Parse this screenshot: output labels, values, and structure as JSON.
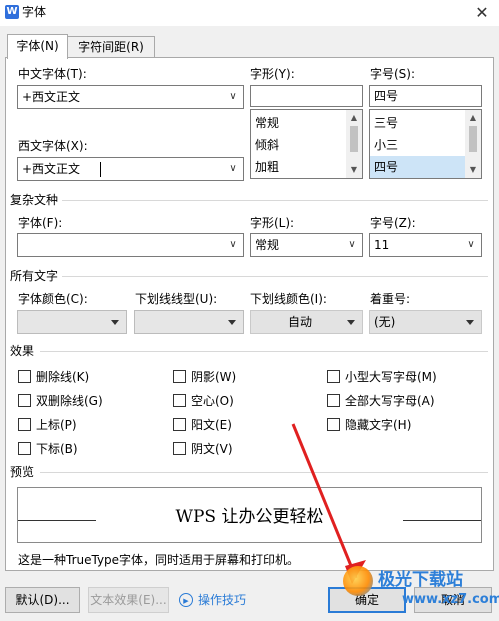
{
  "window": {
    "title": "字体",
    "app_icon_glyph": "W",
    "close_glyph": "✕"
  },
  "tabs": [
    {
      "label": "字体(N)",
      "active": true
    },
    {
      "label": "字符间距(R)",
      "active": false
    }
  ],
  "font_section": {
    "chinese_font_label": "中文字体(T):",
    "chinese_font_value": "+西文正文",
    "western_font_label": "西文字体(X):",
    "western_font_value": "+西文正文",
    "style_label": "字形(Y):",
    "style_value": "",
    "style_options": [
      "常规",
      "倾斜",
      "加粗"
    ],
    "size_label": "字号(S):",
    "size_value": "四号",
    "size_options": [
      "三号",
      "小三",
      "四号"
    ],
    "size_selected": "四号"
  },
  "complex_section": {
    "title": "复杂文种",
    "font_label": "字体(F):",
    "font_value": "",
    "style_label": "字形(L):",
    "style_value": "常规",
    "size_label": "字号(Z):",
    "size_value": "11"
  },
  "all_text_section": {
    "title": "所有文字",
    "color_label": "字体颜色(C):",
    "underline_type_label": "下划线线型(U):",
    "underline_color_label": "下划线颜色(I):",
    "underline_color_value": "自动",
    "emphasis_label": "着重号:",
    "emphasis_value": "(无)"
  },
  "effects_section": {
    "title": "效果",
    "col1": [
      "删除线(K)",
      "双删除线(G)",
      "上标(P)",
      "下标(B)"
    ],
    "col2": [
      "阴影(W)",
      "空心(O)",
      "阳文(E)",
      "阴文(V)"
    ],
    "col3": [
      "小型大写字母(M)",
      "全部大写字母(A)",
      "隐藏文字(H)"
    ]
  },
  "preview": {
    "title": "预览",
    "sample_text": "WPS 让办公更轻松",
    "note": "这是一种TrueType字体，同时适用于屏幕和打印机。"
  },
  "buttons": {
    "default_label": "默认(D)...",
    "text_effect_label": "文本效果(E)...",
    "tips_label": "操作技巧",
    "ok_label": "确定",
    "cancel_label": "取消"
  },
  "watermark": {
    "text": "极光下载站",
    "url": "www.xz7.com"
  },
  "colors": {
    "accent": "#2a7bd6",
    "arrow": "#e02020",
    "selected_item": "#cde4f7"
  }
}
